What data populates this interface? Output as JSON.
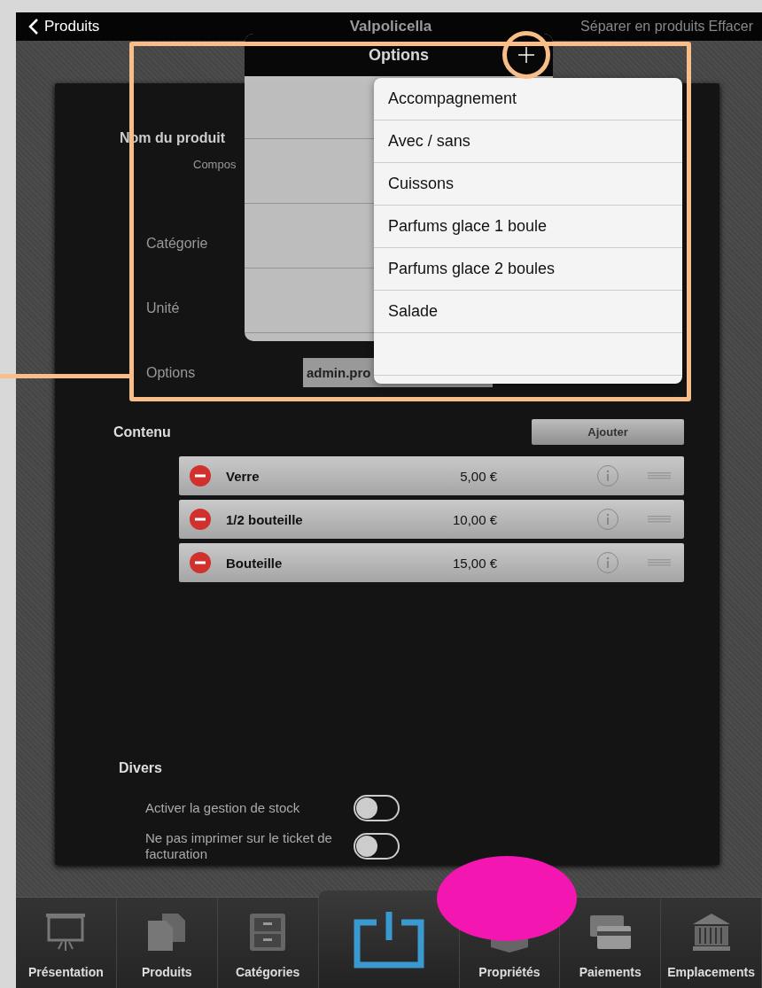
{
  "nav": {
    "back": "Produits",
    "title": "Valpolicella",
    "actions": [
      "Séparer en produits",
      "Effacer"
    ]
  },
  "form": {
    "name_label": "Nom du produit",
    "name_hint": "Compos",
    "fields": [
      {
        "label": "Catégorie"
      },
      {
        "label": "Unité"
      },
      {
        "label": "Options",
        "value": "admin.pro"
      }
    ]
  },
  "contents": {
    "title": "Contenu",
    "add_button": "Ajouter",
    "rows": [
      {
        "name": "Verre",
        "price": "5,00 €"
      },
      {
        "name": "1/2 bouteille",
        "price": "10,00 €"
      },
      {
        "name": "Bouteille",
        "price": "15,00 €"
      }
    ]
  },
  "misc": {
    "title": "Divers",
    "toggles": [
      {
        "label": "Activer la gestion de stock",
        "on": false
      },
      {
        "label": "Ne pas imprimer sur le ticket de facturation",
        "on": false
      }
    ]
  },
  "tabbar": [
    {
      "kind": "presentation",
      "label": "Présentation"
    },
    {
      "kind": "products",
      "label": "Produits"
    },
    {
      "kind": "categories",
      "label": "Catégories"
    },
    {
      "kind": "power"
    },
    {
      "kind": "properties",
      "label": "Propriétés"
    },
    {
      "kind": "payments",
      "label": "Paiements"
    },
    {
      "kind": "locations",
      "label": "Emplacements"
    }
  ],
  "options_popover": {
    "title": "Options"
  },
  "options_menu": {
    "items": [
      "Accompagnement",
      "Avec / sans",
      "Cuissons",
      "Parfums glace 1 boule",
      "Parfums glace 2 boules",
      "Salade"
    ]
  }
}
